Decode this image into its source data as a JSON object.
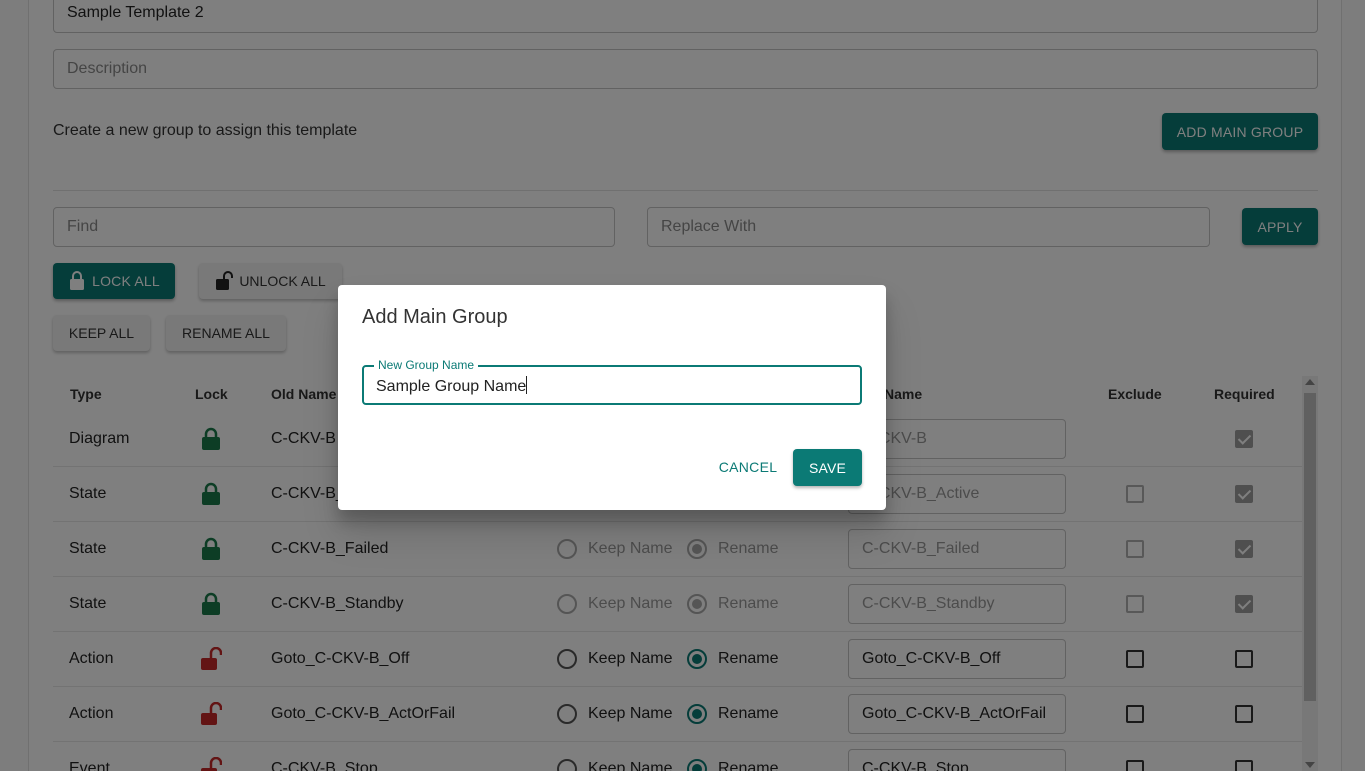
{
  "form": {
    "template_name": "Sample Template 2",
    "description_placeholder": "Description",
    "group_hint": "Create a new group to assign this template",
    "add_main_group_label": "ADD MAIN GROUP",
    "find_placeholder": "Find",
    "replace_placeholder": "Replace With",
    "apply_label": "APPLY",
    "lock_all_label": "LOCK ALL",
    "unlock_all_label": "UNLOCK ALL",
    "keep_all_label": "KEEP ALL",
    "rename_all_label": "RENAME ALL"
  },
  "table": {
    "headers": {
      "type": "Type",
      "lock": "Lock",
      "old_name": "Old Name",
      "new_name": "Name",
      "exclude": "Exclude",
      "required": "Required"
    },
    "radio_keep_label": "Keep Name",
    "radio_rename_label": "Rename",
    "rows": [
      {
        "type": "Diagram",
        "locked": true,
        "old_name": "C-CKV-B",
        "new_name": "C-CKV-B",
        "exclude": null,
        "required": true
      },
      {
        "type": "State",
        "locked": true,
        "old_name": "C-CKV-B_Active",
        "new_name": "C-CKV-B_Active",
        "exclude": false,
        "required": true
      },
      {
        "type": "State",
        "locked": true,
        "old_name": "C-CKV-B_Failed",
        "new_name": "C-CKV-B_Failed",
        "exclude": false,
        "required": true
      },
      {
        "type": "State",
        "locked": true,
        "old_name": "C-CKV-B_Standby",
        "new_name": "C-CKV-B_Standby",
        "exclude": false,
        "required": true
      },
      {
        "type": "Action",
        "locked": false,
        "old_name": "Goto_C-CKV-B_Off",
        "new_name": "Goto_C-CKV-B_Off",
        "exclude": false,
        "required": false
      },
      {
        "type": "Action",
        "locked": false,
        "old_name": "Goto_C-CKV-B_ActOrFail",
        "new_name": "Goto_C-CKV-B_ActOrFail",
        "exclude": false,
        "required": false
      },
      {
        "type": "Event",
        "locked": false,
        "old_name": "C-CKV-B_Stop",
        "new_name": "C-CKV-B_Stop",
        "exclude": false,
        "required": false
      }
    ]
  },
  "dialog": {
    "title": "Add Main Group",
    "field_label": "New Group Name",
    "field_value": "Sample Group Name",
    "cancel_label": "CANCEL",
    "save_label": "SAVE"
  },
  "colors": {
    "accent": "#0b7a75",
    "lock_green": "#1a7a4a",
    "unlock_red": "#c62828"
  }
}
